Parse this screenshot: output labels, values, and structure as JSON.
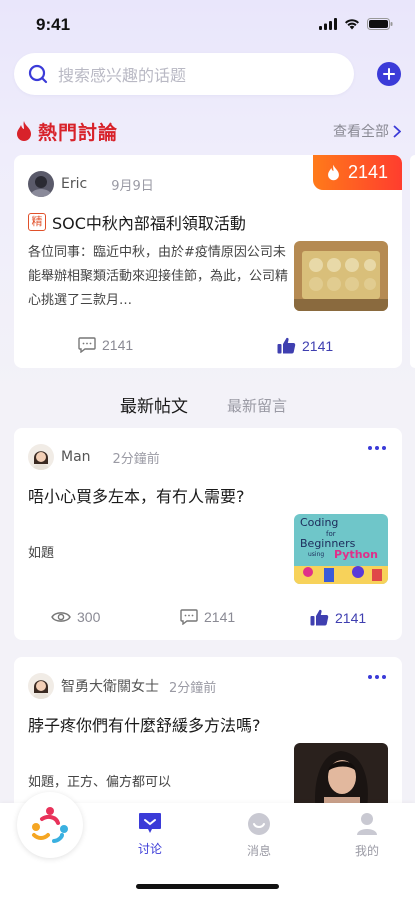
{
  "status_bar": {
    "time": "9:41"
  },
  "search": {
    "placeholder": "搜索感兴趣的话题"
  },
  "hot_section": {
    "title": "熱門討論",
    "see_all": "查看全部"
  },
  "hot_post": {
    "heat": "2141",
    "author": "Eric",
    "date": "9月9日",
    "tag": "精",
    "title": "SOC中秋內部福利領取活動",
    "excerpt": "各位同事：臨近中秋，由於#疫情原因公司未能舉辦相聚類活動來迎接佳節，為此，公司精心挑選了三款月…",
    "comments": "2141",
    "likes": "2141"
  },
  "feed_tabs": {
    "latest_posts": "最新帖文",
    "latest_comments": "最新留言"
  },
  "feed": [
    {
      "author": "Man",
      "time": "2分鐘前",
      "title": "唔小心買多左本，有冇人需要?",
      "subtitle": "如題",
      "views": "300",
      "comments": "2141",
      "likes": "2141",
      "thumb_text": [
        "Coding",
        "for",
        "Beginners",
        "using",
        "Python"
      ]
    },
    {
      "author": "智勇大衛關女士",
      "time": "2分鐘前",
      "title": "脖子疼你們有什麼舒緩多方法嗎?",
      "subtitle": "如題，正方、偏方都可以"
    }
  ],
  "tabbar": {
    "discuss": "讨论",
    "messages": "消息",
    "mine": "我的"
  },
  "colors": {
    "accent": "#3b3bd8",
    "hot_red": "#d8222a",
    "badge_orange": "#ff5a24"
  }
}
